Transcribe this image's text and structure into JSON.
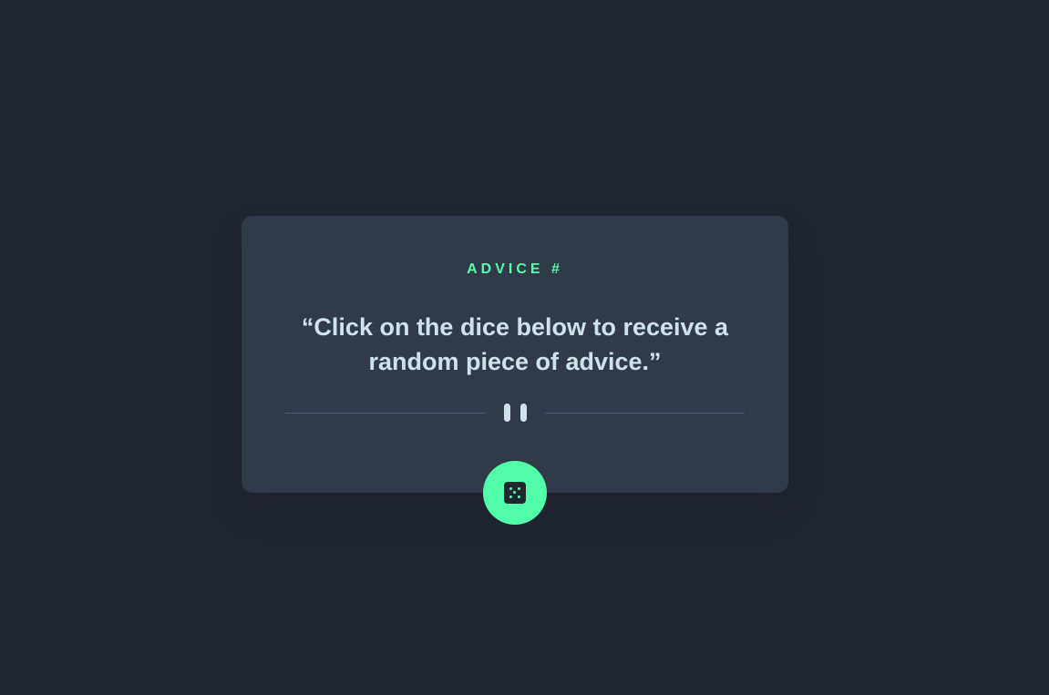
{
  "card": {
    "title": "ADVICE #",
    "quote": "“Click on the dice below to receive a random piece of advice.”"
  },
  "divider": {
    "icon": "pause-icon"
  },
  "dice_button": {
    "icon": "dice-icon"
  },
  "colors": {
    "background": "#202632",
    "card": "#313a4b",
    "accent": "#52ffa8",
    "text": "#cee3e9",
    "divider": "#4f5d74"
  }
}
